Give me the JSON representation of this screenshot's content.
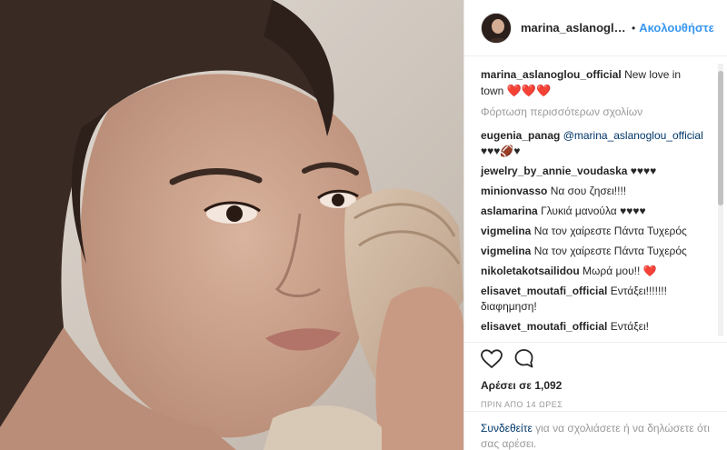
{
  "post": {
    "author": "marina_aslanoglou...",
    "follow_label": "Ακολουθήστε",
    "separator": "•"
  },
  "caption": {
    "user": "marina_aslanoglou_official",
    "text": "New love in town",
    "hearts": "❤️❤️❤️"
  },
  "load_more": "Φόρτωση περισσότερων σχολίων",
  "comments": [
    {
      "user": "eugenia_panag",
      "mention": "@marina_aslanoglou_official",
      "text": " ♥♥♥🏈♥"
    },
    {
      "user": "jewelry_by_annie_voudaska",
      "mention": "",
      "text": " ♥♥♥♥"
    },
    {
      "user": "minionvasso",
      "mention": "",
      "text": " Να σου ζησει!!!!"
    },
    {
      "user": "aslamarina",
      "mention": "",
      "text": " Γλυκιά μανούλα ♥♥♥♥"
    },
    {
      "user": "vigmelina",
      "mention": "",
      "text": " Να τον χαίρεστε Πάντα Τυχερός"
    },
    {
      "user": "vigmelina",
      "mention": "",
      "text": " Να τον χαίρεστε Πάντα Τυχερός"
    },
    {
      "user": "nikoletakotsailidou",
      "mention": "",
      "text": " Μωρά μου!! ❤️"
    },
    {
      "user": "elisavet_moutafi_official",
      "mention": "",
      "text": " Εντάξει!!!!!!! διαφημηση!"
    },
    {
      "user": "elisavet_moutafi_official",
      "mention": "",
      "text": " Εντάξει!"
    }
  ],
  "likes": "Αρέσει σε 1,092",
  "timestamp": "ΠΡΙΝ ΑΠΟ 14 ΩΡΕΣ",
  "footer": {
    "login_link": "Συνδεθείτε",
    "text": " για να σχολιάσετε ή να δηλώσετε ότι σας αρέσει."
  },
  "icons": {
    "like": "heart-outline-icon",
    "comment": "comment-bubble-icon"
  }
}
